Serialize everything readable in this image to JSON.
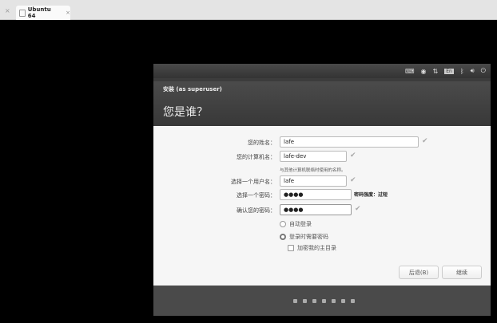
{
  "browser": {
    "tab_title": "Ubuntu 64",
    "close": "×"
  },
  "panel": {
    "icons": [
      "keyboard-icon",
      "accessibility-icon",
      "network-icon",
      "language-icon",
      "bluetooth-icon",
      "volume-icon",
      "power-icon"
    ],
    "lang": "En"
  },
  "header": {
    "subtitle": "安装 (as superuser)",
    "title": "您是谁？"
  },
  "form": {
    "name_label": "您的姓名：",
    "name_value": "lafe",
    "computer_label": "您的计算机名：",
    "computer_value": "lafe-dev",
    "computer_hint": "与其他计算机联络时使用的名称。",
    "user_label": "选择一个用户名：",
    "user_value": "lafe",
    "pass_label": "选择一个密码：",
    "pass_value": "●●●●",
    "pass_strength": "密码强度：过短",
    "confirm_label": "确认您的密码：",
    "confirm_value": "●●●●",
    "check": "✔",
    "auto_login": "自动登录",
    "require_pass": "登录时需要密码",
    "encrypt_home": "加密我的主目录"
  },
  "buttons": {
    "back": "后退(B)",
    "continue": "继续"
  },
  "progress": {
    "steps": 7
  }
}
